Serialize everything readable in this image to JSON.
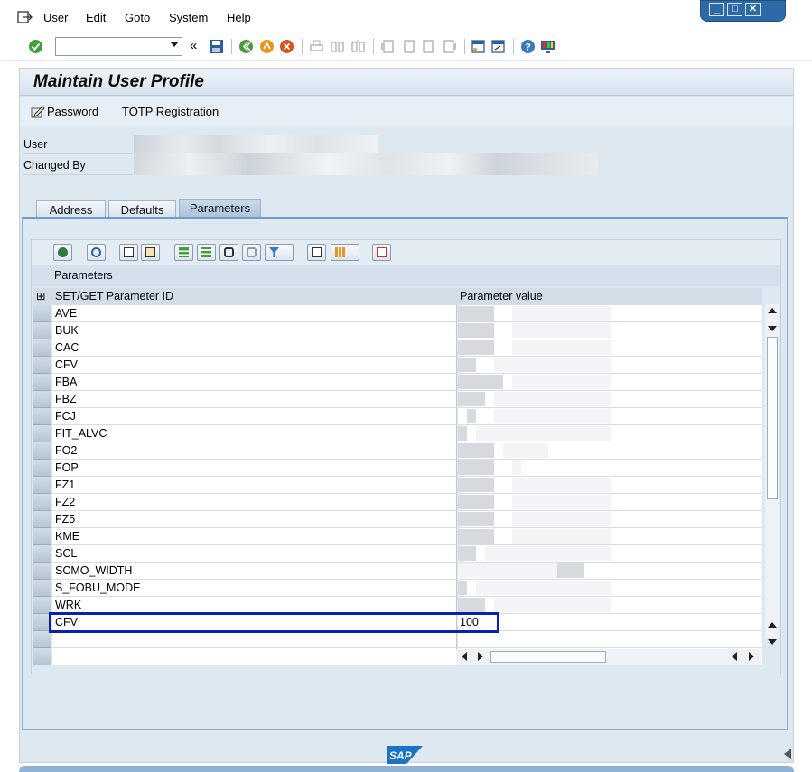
{
  "menu": [
    {
      "label": "User",
      "key": "U"
    },
    {
      "label": "Edit",
      "key": "E"
    },
    {
      "label": "Goto",
      "key": "G"
    },
    {
      "label": "System",
      "key": "S"
    },
    {
      "label": "Help",
      "key": "H"
    }
  ],
  "toolbar": {
    "command_field_value": "",
    "enter_icon": "check-circle-icon",
    "save_icon": "floppy-icon",
    "icons": [
      "back-icon",
      "exit-icon",
      "cancel-icon",
      "print-icon",
      "find-icon",
      "find-next-icon",
      "first-page-icon",
      "prev-page-icon",
      "next-page-icon",
      "last-page-icon",
      "new-session-icon",
      "shortcut-icon",
      "help-icon",
      "customize-layout-icon"
    ]
  },
  "window_controls": [
    "minimize-icon",
    "maximize-icon",
    "close-icon"
  ],
  "page_title": "Maintain User Profile",
  "app_toolbar": {
    "password_label": "Password",
    "totp_label": "TOTP Registration"
  },
  "header_fields": {
    "user_label": "User",
    "changed_by_label": "Changed By"
  },
  "tabs": [
    {
      "label": "Address",
      "active": false
    },
    {
      "label": "Defaults",
      "active": false
    },
    {
      "label": "Parameters",
      "active": true
    }
  ],
  "grid": {
    "title": "Parameters",
    "columns": [
      "SET/GET Parameter ID",
      "Parameter value"
    ],
    "rows": [
      {
        "id": "AVE",
        "value": ""
      },
      {
        "id": "BUK",
        "value": ""
      },
      {
        "id": "CAC",
        "value": ""
      },
      {
        "id": "CFV",
        "value": ""
      },
      {
        "id": "FBA",
        "value": ""
      },
      {
        "id": "FBZ",
        "value": ""
      },
      {
        "id": "FCJ",
        "value": ""
      },
      {
        "id": "FIT_ALVC",
        "value": ""
      },
      {
        "id": "FO2",
        "value": ""
      },
      {
        "id": "FOP",
        "value": ""
      },
      {
        "id": "FZ1",
        "value": ""
      },
      {
        "id": "FZ2",
        "value": ""
      },
      {
        "id": "FZ5",
        "value": ""
      },
      {
        "id": "KME",
        "value": ""
      },
      {
        "id": "SCL",
        "value": ""
      },
      {
        "id": "SCMO_WIDTH",
        "value": ""
      },
      {
        "id": "S_FOBU_MODE",
        "value": ""
      },
      {
        "id": "WRK",
        "value": ""
      },
      {
        "id": "CFV",
        "value": "100"
      },
      {
        "id": "",
        "value": ""
      },
      {
        "id": "",
        "value": ""
      }
    ]
  },
  "colors": {
    "accent": "#0a1fb4",
    "frame_bg": "#dee8f1",
    "tab_border": "#6f9cc8"
  }
}
